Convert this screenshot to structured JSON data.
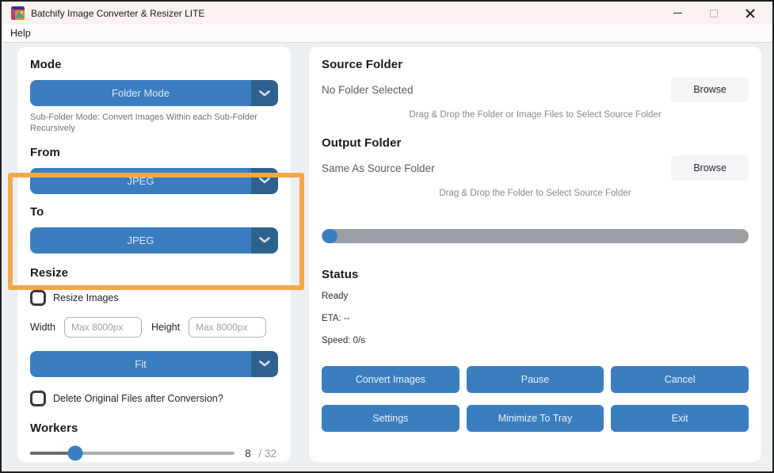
{
  "window": {
    "title": "Batchify Image Converter & Resizer LITE"
  },
  "menubar": {
    "help_label": "Help"
  },
  "left_panel": {
    "mode": {
      "heading": "Mode",
      "selected": "Folder Mode",
      "description": "Sub-Folder Mode: Convert Images Within each Sub-Folder Recursively"
    },
    "from": {
      "heading": "From",
      "selected": "JPEG"
    },
    "to": {
      "heading": "To",
      "selected": "JPEG"
    },
    "resize": {
      "heading": "Resize",
      "checkbox_label": "Resize Images",
      "width_label": "Width",
      "width_placeholder": "Max 8000px",
      "height_label": "Height",
      "height_placeholder": "Max 8000px",
      "fit_selected": "Fit"
    },
    "delete_checkbox_label": "Delete Original Files after Conversion?",
    "workers": {
      "heading": "Workers",
      "value": "8",
      "max": "/ 32"
    }
  },
  "right_panel": {
    "source_folder": {
      "heading": "Source Folder",
      "value": "No Folder Selected",
      "browse_label": "Browse",
      "hint": "Drag & Drop the Folder or Image Files to Select Source Folder"
    },
    "output_folder": {
      "heading": "Output Folder",
      "value": "Same As Source Folder",
      "browse_label": "Browse",
      "hint": "Drag & Drop the Folder to Select Source Folder"
    },
    "progress_percent": 0,
    "status": {
      "heading": "Status",
      "state": "Ready",
      "eta": "ETA: --",
      "speed": "Speed: 0/s"
    },
    "buttons": {
      "convert": "Convert Images",
      "pause": "Pause",
      "cancel": "Cancel",
      "settings": "Settings",
      "minimize_to_tray": "Minimize To Tray",
      "exit": "Exit"
    }
  },
  "colors": {
    "primary_blue": "#3b7ec0",
    "caret_blue": "#2f618f",
    "highlight_orange": "#f3a74b",
    "progress_track_gray": "#9aa0a5",
    "titlebar_cream": "#f9f2ee"
  }
}
